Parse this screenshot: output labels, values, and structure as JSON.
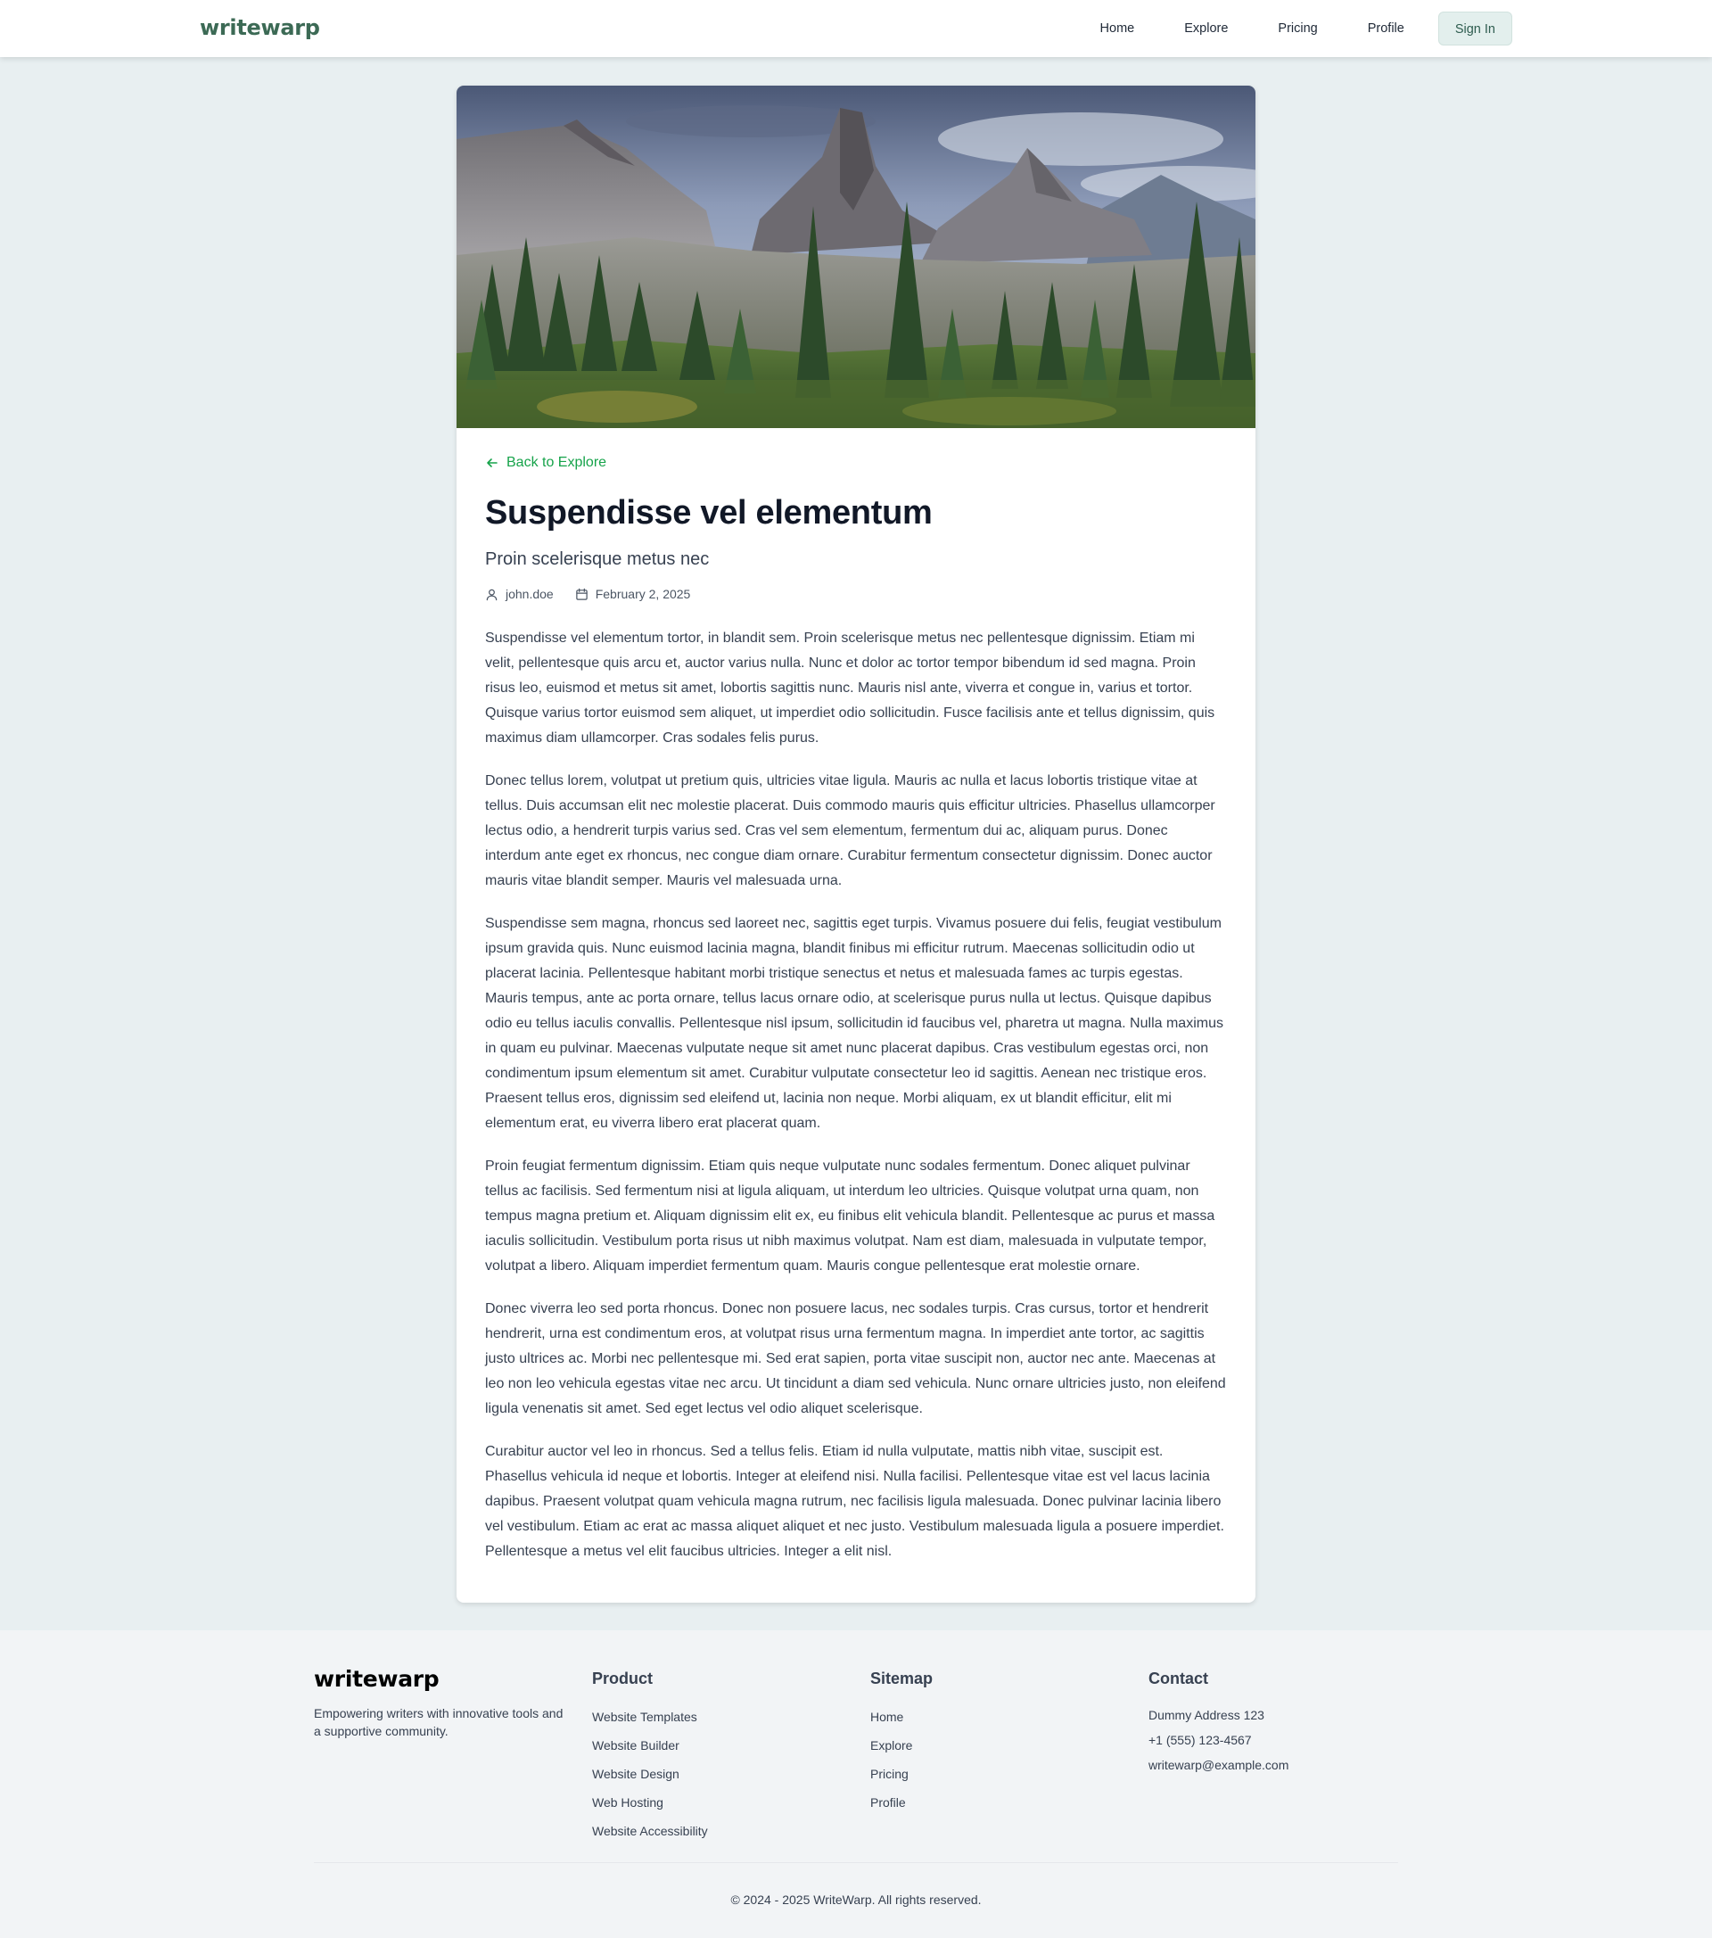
{
  "header": {
    "brand": "writewarp",
    "nav": [
      "Home",
      "Explore",
      "Pricing",
      "Profile"
    ],
    "signin_label": "Sign In"
  },
  "article": {
    "back_label": "Back to Explore",
    "title": "Suspendisse vel elementum",
    "subtitle": "Proin scelerisque metus nec",
    "author": "john.doe",
    "date": "February 2, 2025",
    "paragraphs": [
      "Suspendisse vel elementum tortor, in blandit sem. Proin scelerisque metus nec pellentesque dignissim. Etiam mi velit, pellentesque quis arcu et, auctor varius nulla. Nunc et dolor ac tortor tempor bibendum id sed magna. Proin risus leo, euismod et metus sit amet, lobortis sagittis nunc. Mauris nisl ante, viverra et congue in, varius et tortor. Quisque varius tortor euismod sem aliquet, ut imperdiet odio sollicitudin. Fusce facilisis ante et tellus dignissim, quis maximus diam ullamcorper. Cras sodales felis purus.",
      "Donec tellus lorem, volutpat ut pretium quis, ultricies vitae ligula. Mauris ac nulla et lacus lobortis tristique vitae at tellus. Duis accumsan elit nec molestie placerat. Duis commodo mauris quis efficitur ultricies. Phasellus ullamcorper lectus odio, a hendrerit turpis varius sed. Cras vel sem elementum, fermentum dui ac, aliquam purus. Donec interdum ante eget ex rhoncus, nec congue diam ornare. Curabitur fermentum consectetur dignissim. Donec auctor mauris vitae blandit semper. Mauris vel malesuada urna.",
      "Suspendisse sem magna, rhoncus sed laoreet nec, sagittis eget turpis. Vivamus posuere dui felis, feugiat vestibulum ipsum gravida quis. Nunc euismod lacinia magna, blandit finibus mi efficitur rutrum. Maecenas sollicitudin odio ut placerat lacinia. Pellentesque habitant morbi tristique senectus et netus et malesuada fames ac turpis egestas. Mauris tempus, ante ac porta ornare, tellus lacus ornare odio, at scelerisque purus nulla ut lectus. Quisque dapibus odio eu tellus iaculis convallis. Pellentesque nisl ipsum, sollicitudin id faucibus vel, pharetra ut magna. Nulla maximus in quam eu pulvinar. Maecenas vulputate neque sit amet nunc placerat dapibus. Cras vestibulum egestas orci, non condimentum ipsum elementum sit amet. Curabitur vulputate consectetur leo id sagittis. Aenean nec tristique eros. Praesent tellus eros, dignissim sed eleifend ut, lacinia non neque. Morbi aliquam, ex ut blandit efficitur, elit mi elementum erat, eu viverra libero erat placerat quam.",
      "Proin feugiat fermentum dignissim. Etiam quis neque vulputate nunc sodales fermentum. Donec aliquet pulvinar tellus ac facilisis. Sed fermentum nisi at ligula aliquam, ut interdum leo ultricies. Quisque volutpat urna quam, non tempus magna pretium et. Aliquam dignissim elit ex, eu finibus elit vehicula blandit. Pellentesque ac purus et massa iaculis sollicitudin. Vestibulum porta risus ut nibh maximus volutpat. Nam est diam, malesuada in vulputate tempor, volutpat a libero. Aliquam imperdiet fermentum quam. Mauris congue pellentesque erat molestie ornare.",
      "Donec viverra leo sed porta rhoncus. Donec non posuere lacus, nec sodales turpis. Cras cursus, tortor et hendrerit hendrerit, urna est condimentum eros, at volutpat risus urna fermentum magna. In imperdiet ante tortor, ac sagittis justo ultrices ac. Morbi nec pellentesque mi. Sed erat sapien, porta vitae suscipit non, auctor nec ante. Maecenas at leo non leo vehicula egestas vitae nec arcu. Ut tincidunt a diam sed vehicula. Nunc ornare ultricies justo, non eleifend ligula venenatis sit amet. Sed eget lectus vel odio aliquet scelerisque.",
      "Curabitur auctor vel leo in rhoncus. Sed a tellus felis. Etiam id nulla vulputate, mattis nibh vitae, suscipit est. Phasellus vehicula id neque et lobortis. Integer at eleifend nisi. Nulla facilisi. Pellentesque vitae est vel lacus lacinia dapibus. Praesent volutpat quam vehicula magna rutrum, nec facilisis ligula malesuada. Donec pulvinar lacinia libero vel vestibulum. Etiam ac erat ac massa aliquet aliquet et nec justo. Vestibulum malesuada ligula a posuere imperdiet. Pellentesque a metus vel elit faucibus ultricies. Integer a elit nisl."
    ]
  },
  "footer": {
    "brand": "writewarp",
    "tagline": "Empowering writers with innovative tools and a supportive community.",
    "product": {
      "heading": "Product",
      "items": [
        "Website Templates",
        "Website Builder",
        "Website Design",
        "Web Hosting",
        "Website Accessibility"
      ]
    },
    "sitemap": {
      "heading": "Sitemap",
      "items": [
        "Home",
        "Explore",
        "Pricing",
        "Profile"
      ]
    },
    "contact": {
      "heading": "Contact",
      "address": "Dummy Address 123",
      "phone": "+1 (555) 123-4567",
      "email": "writewarp@example.com"
    },
    "copyright": "© 2024 - 2025 WriteWarp. All rights reserved."
  },
  "colors": {
    "brand": "#3c6a55",
    "accent": "#16a34a",
    "page_bg": "#e8eff1",
    "footer_bg": "#f2f4f6"
  },
  "icons": [
    "arrow-left-icon",
    "user-icon",
    "calendar-icon"
  ]
}
